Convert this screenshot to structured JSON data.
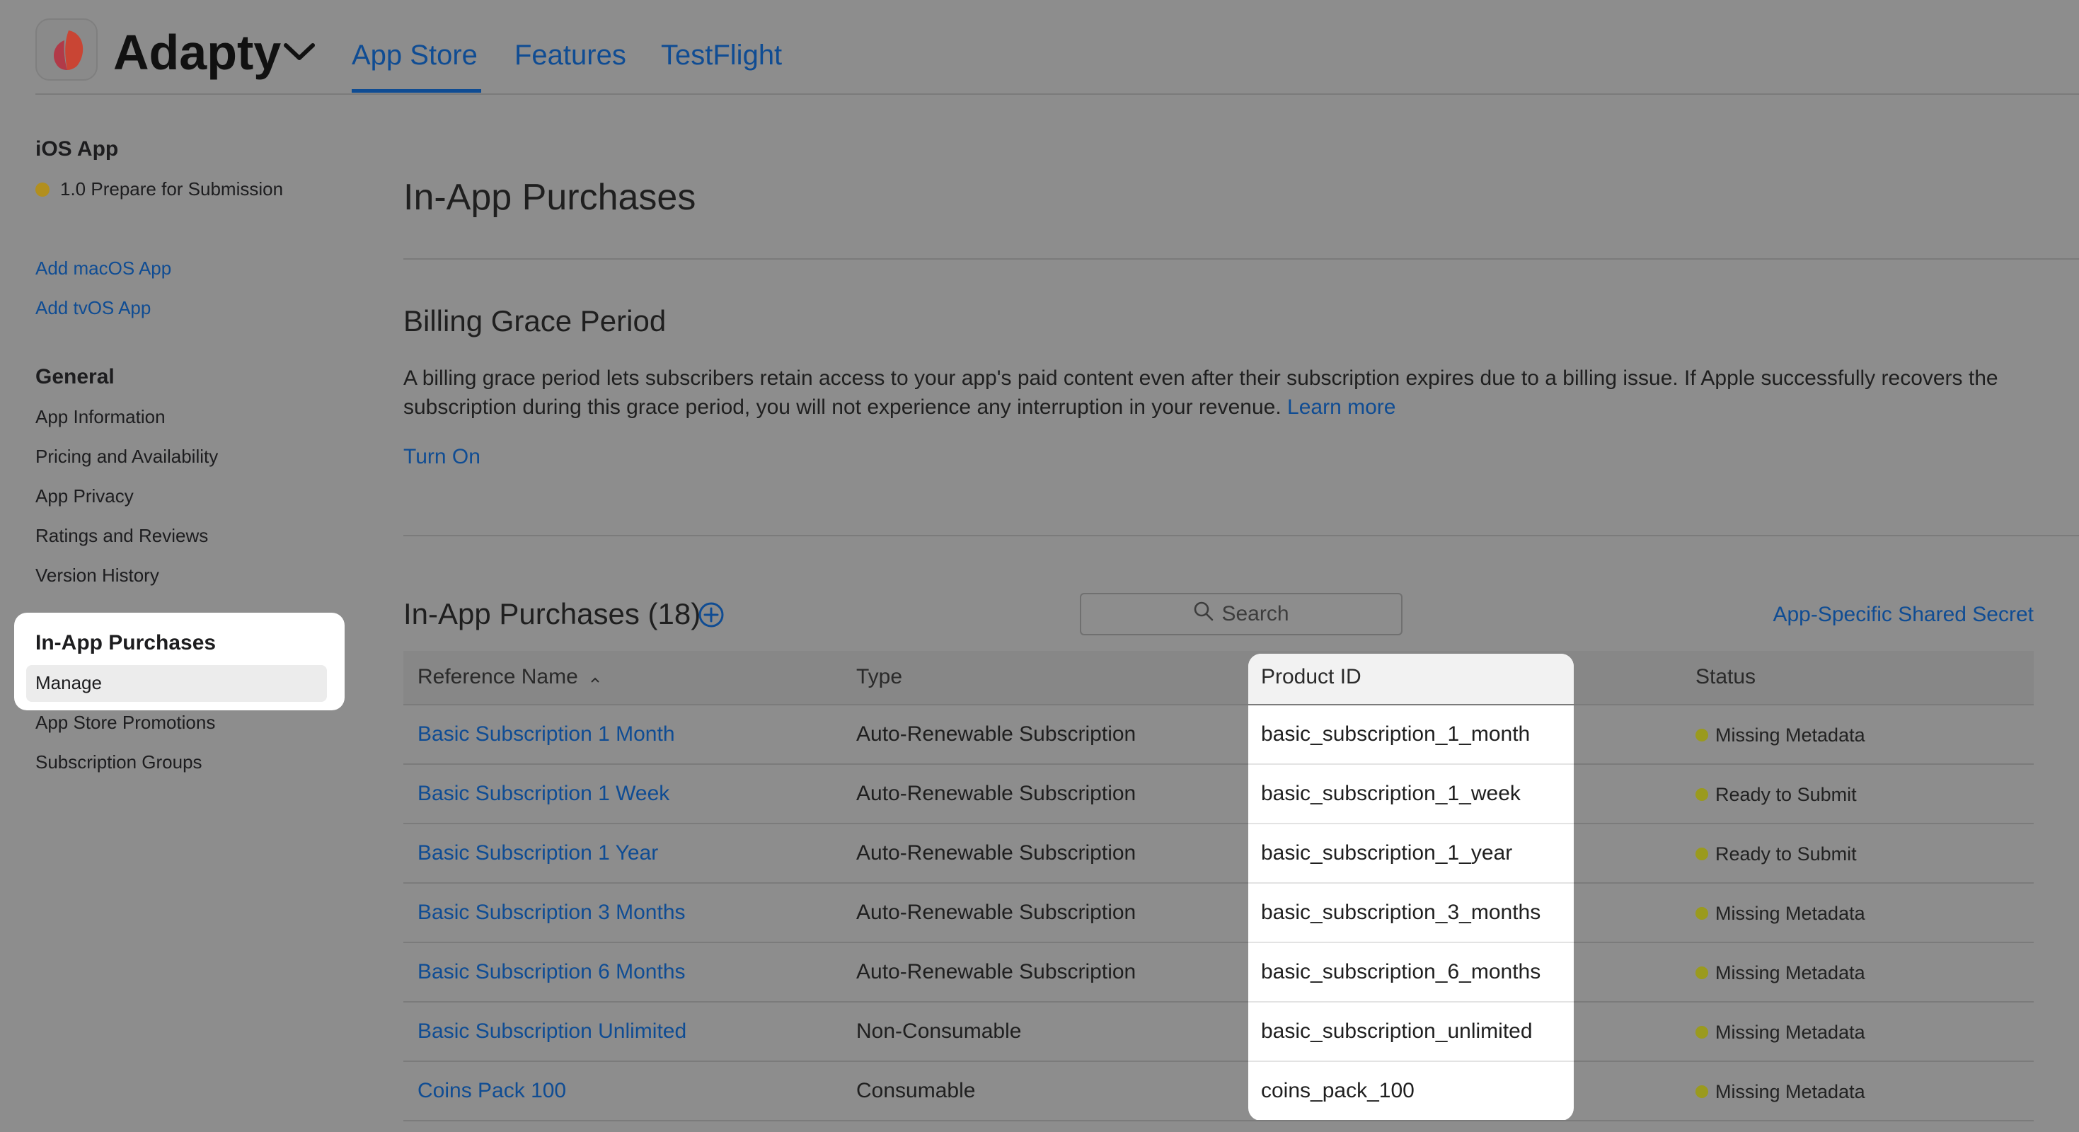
{
  "header": {
    "app_name": "Adapty",
    "tabs": [
      {
        "label": "App Store",
        "active": true
      },
      {
        "label": "Features",
        "active": false
      },
      {
        "label": "TestFlight",
        "active": false
      }
    ]
  },
  "sidebar": {
    "platform_title": "iOS App",
    "version_status": "1.0 Prepare for Submission",
    "add_links": [
      "Add macOS App",
      "Add tvOS App"
    ],
    "general_title": "General",
    "general_items": [
      "App Information",
      "Pricing and Availability",
      "App Privacy",
      "Ratings and Reviews",
      "Version History"
    ],
    "iap_title": "In-App Purchases",
    "iap_items": [
      "Manage",
      "App Store Promotions",
      "Subscription Groups"
    ]
  },
  "main": {
    "title": "In-App Purchases",
    "billing": {
      "title": "Billing Grace Period",
      "description": "A billing grace period lets subscribers retain access to your app's paid content even after their subscription expires due to a billing issue. If Apple successfully recovers the subscription during this grace period, you will not experience any interruption in your revenue.",
      "learn_more": "Learn more",
      "turn_on": "Turn On"
    },
    "list": {
      "title": "In-App Purchases (18)",
      "search_placeholder": "Search",
      "shared_secret": "App-Specific Shared Secret",
      "columns": [
        "Reference Name",
        "Type",
        "Product ID",
        "Status"
      ],
      "sort_indicator": "^",
      "rows": [
        {
          "name": "Basic Subscription 1 Month",
          "type": "Auto-Renewable Subscription",
          "product_id": "basic_subscription_1_month",
          "status": "Missing Metadata"
        },
        {
          "name": "Basic Subscription 1 Week",
          "type": "Auto-Renewable Subscription",
          "product_id": "basic_subscription_1_week",
          "status": "Ready to Submit"
        },
        {
          "name": "Basic Subscription 1 Year",
          "type": "Auto-Renewable Subscription",
          "product_id": "basic_subscription_1_year",
          "status": "Ready to Submit"
        },
        {
          "name": "Basic Subscription 3 Months",
          "type": "Auto-Renewable Subscription",
          "product_id": "basic_subscription_3_months",
          "status": "Missing Metadata"
        },
        {
          "name": "Basic Subscription 6 Months",
          "type": "Auto-Renewable Subscription",
          "product_id": "basic_subscription_6_months",
          "status": "Missing Metadata"
        },
        {
          "name": "Basic Subscription Unlimited",
          "type": "Non-Consumable",
          "product_id": "basic_subscription_unlimited",
          "status": "Missing Metadata"
        },
        {
          "name": "Coins Pack 100",
          "type": "Consumable",
          "product_id": "coins_pack_100",
          "status": "Missing Metadata"
        }
      ]
    }
  },
  "colors": {
    "link": "#0f4c93",
    "status_missing": "#9a9a1e",
    "status_ready": "#9a9a1e",
    "version_dot": "#b28f1e",
    "overlay": "#8d8d8d",
    "highlight": "#ffffff"
  },
  "icons": {
    "app_logo": "adapty-logo-icon",
    "chevron": "chevron-down-icon",
    "add": "plus-circle-icon",
    "search": "search-icon",
    "sort": "sort-ascending-icon"
  }
}
